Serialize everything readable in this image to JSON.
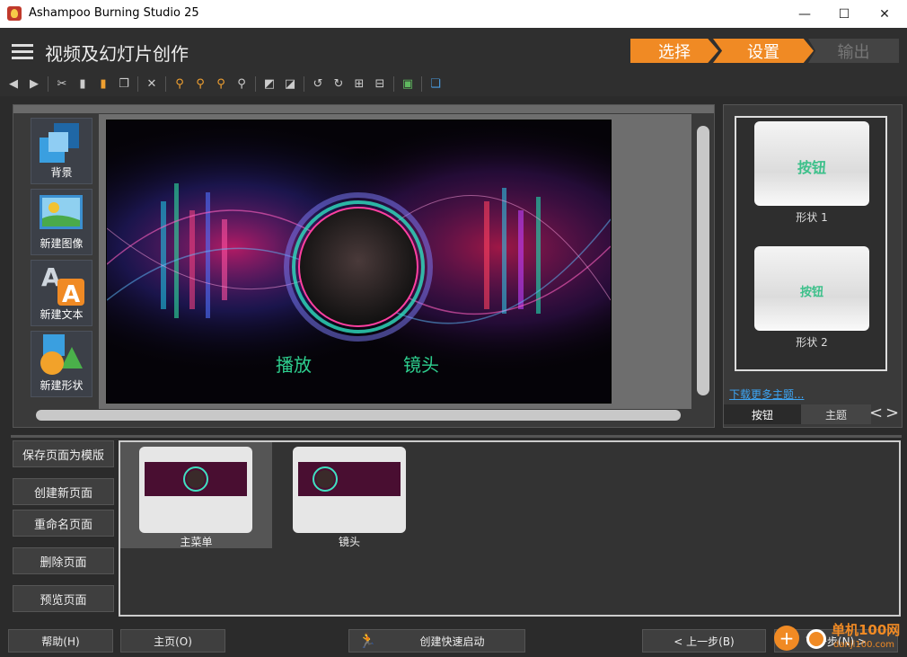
{
  "window": {
    "title": "Ashampoo Burning Studio 25",
    "minimize": "—",
    "maximize": "☐",
    "close": "✕"
  },
  "header": {
    "title": "视频及幻灯片创作",
    "steps": [
      {
        "label": "选择",
        "state": "done"
      },
      {
        "label": "设置",
        "state": "active"
      },
      {
        "label": "输出",
        "state": "inactive"
      }
    ]
  },
  "toolbar": {
    "icons": [
      "back-icon",
      "forward-icon",
      "cut-icon",
      "copy-icon",
      "paste-icon",
      "duplicate-icon",
      "delete-icon",
      "zoom-fit-icon",
      "zoom-in-icon",
      "zoom-out-icon",
      "zoom-reset-icon",
      "bring-front-icon",
      "send-back-icon",
      "rotate-left-icon",
      "rotate-right-icon",
      "align-icon",
      "distribute-icon",
      "image-icon",
      "layers-icon"
    ]
  },
  "tools": [
    {
      "label": "背景",
      "icon": "background-icon"
    },
    {
      "label": "新建图像",
      "icon": "new-image-icon"
    },
    {
      "label": "新建文本",
      "icon": "new-text-icon"
    },
    {
      "label": "新建形状",
      "icon": "new-shape-icon"
    }
  ],
  "preview": {
    "button_play": "播放",
    "button_scenes": "镜头",
    "accent": "#2ecf8f"
  },
  "right_panel": {
    "shapes": [
      {
        "text": "按钮",
        "label": "形状 1"
      },
      {
        "text": "按钮",
        "label": "形状 2"
      }
    ],
    "more_link": "下载更多主题...",
    "tabs": [
      {
        "label": "按钮",
        "active": true
      },
      {
        "label": "主题",
        "active": false
      }
    ],
    "prev": "<",
    "next": ">"
  },
  "page_actions": [
    "保存页面为模版",
    "创建新页面",
    "重命名页面",
    "删除页面",
    "预览页面"
  ],
  "pages": [
    {
      "label": "主菜单",
      "selected": true
    },
    {
      "label": "镜头",
      "selected": false
    }
  ],
  "footer": {
    "help": "帮助(H)",
    "home": "主页(O)",
    "quick_launch": "创建快速启动",
    "prev_step": "< 上一步(B)",
    "next_step": "下一步(N) >"
  },
  "watermark": {
    "brand": "单机100网",
    "url": "danji100.com"
  },
  "colors": {
    "accent_orange": "#f08a24",
    "link": "#3da5f4",
    "button_text": "#3cc08a"
  }
}
